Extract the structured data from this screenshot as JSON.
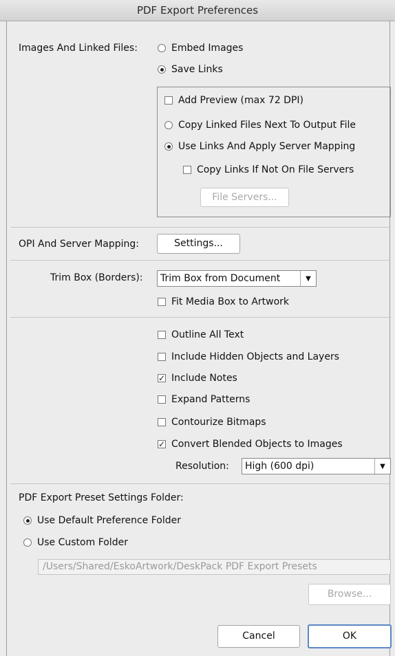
{
  "window": {
    "title": "PDF Export Preferences"
  },
  "images": {
    "label": "Images And Linked Files:",
    "embed_label": "Embed Images",
    "save_links_label": "Save Links",
    "add_preview_label": "Add Preview (max 72 DPI)",
    "copy_linked_label": "Copy Linked Files Next To Output File",
    "use_links_label": "Use Links And Apply Server Mapping",
    "copy_if_not_label": "Copy Links If Not On File Servers",
    "file_servers_button": "File Servers..."
  },
  "opi": {
    "label": "OPI And Server Mapping:",
    "settings_button": "Settings..."
  },
  "trim": {
    "label": "Trim Box (Borders):",
    "selected": "Trim Box from Document",
    "fit_media_label": "Fit Media Box to Artwork"
  },
  "options": {
    "outline_text": "Outline All Text",
    "hidden_objects": "Include Hidden Objects and Layers",
    "include_notes": "Include Notes",
    "expand_patterns": "Expand Patterns",
    "contourize": "Contourize Bitmaps",
    "convert_blended": "Convert Blended Objects to Images",
    "resolution_label": "Resolution:",
    "resolution_selected": "High (600 dpi)"
  },
  "preset": {
    "label": "PDF Export Preset Settings Folder:",
    "default_label": "Use Default Preference Folder",
    "custom_label": "Use Custom Folder",
    "path_value": "/Users/Shared/EskoArtwork/DeskPack PDF Export Presets",
    "browse_button": "Browse..."
  },
  "footer": {
    "cancel": "Cancel",
    "ok": "OK"
  },
  "icons": {
    "check": "✓",
    "dropdown": "▼"
  }
}
